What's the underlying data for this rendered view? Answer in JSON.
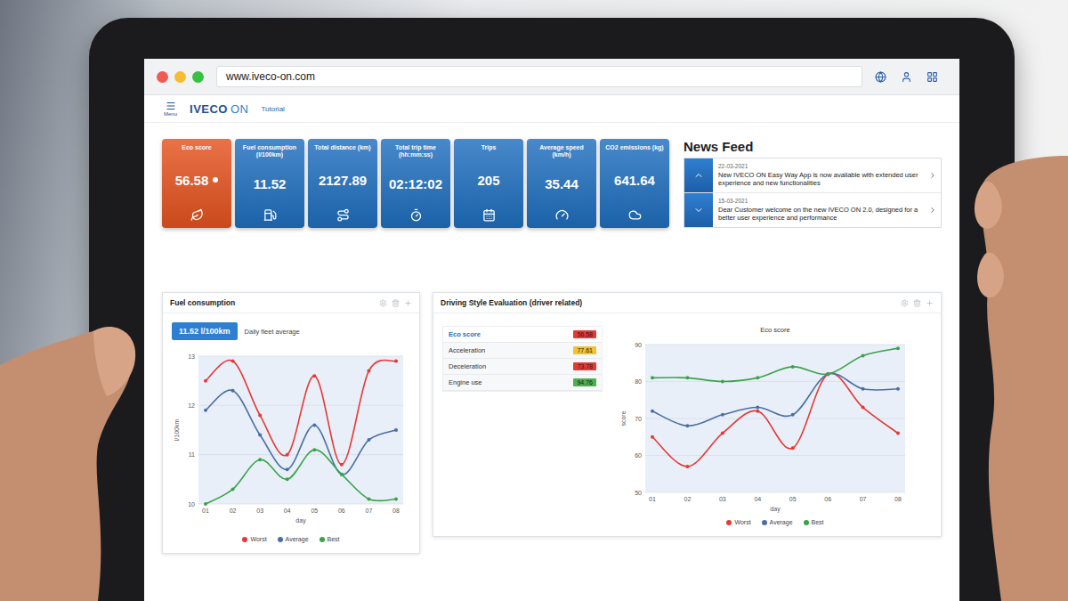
{
  "browser": {
    "url": "www.iveco-on.com"
  },
  "header": {
    "menu_label": "Menu",
    "logo_brand": "IVECO",
    "logo_product": "ON",
    "nav_link": "Tutorial"
  },
  "kpis": [
    {
      "label": "Eco score",
      "value": "56.58",
      "color": "#e5531f"
    },
    {
      "label": "Fuel consumption (l/100km)",
      "value": "11.52",
      "color": "#1f6fbf"
    },
    {
      "label": "Total distance (km)",
      "value": "2127.89",
      "color": "#1f6fbf"
    },
    {
      "label": "Total trip time (hh:mm:ss)",
      "value": "02:12:02",
      "color": "#1f6fbf"
    },
    {
      "label": "Trips",
      "value": "205",
      "color": "#1f6fbf"
    },
    {
      "label": "Average speed (km/h)",
      "value": "35.44",
      "color": "#1f6fbf"
    },
    {
      "label": "CO2 emissions (kg)",
      "value": "641.64",
      "color": "#1f6fbf"
    }
  ],
  "news_feed": {
    "title": "News Feed",
    "items": [
      {
        "date": "22-03-2021",
        "text": "New IVECO ON Easy Way App is now available with extended user experience and new functionalities"
      },
      {
        "date": "15-03-2021",
        "text": "Dear Customer welcome on the new IVECO ON 2.0, designed for a better user experience and performance"
      }
    ]
  },
  "fuel_panel": {
    "title": "Fuel consumption",
    "badge": "11.52 l/100km",
    "badge_caption": "Daily fleet average",
    "chart": {
      "y_label": "l/100km",
      "y_ticks": [
        "13",
        "12",
        "11",
        "10"
      ],
      "x_ticks": [
        "01",
        "02",
        "03",
        "04",
        "05",
        "06",
        "07",
        "08"
      ],
      "x_label": "day",
      "series": [
        {
          "name": "Worst",
          "color": "#e53935",
          "values": [
            12.5,
            12.9,
            11.8,
            11.0,
            12.6,
            10.8,
            12.7,
            12.9
          ]
        },
        {
          "name": "Average",
          "color": "#4a6fa5",
          "values": [
            11.9,
            12.3,
            11.4,
            10.7,
            11.6,
            10.6,
            11.3,
            11.5
          ]
        },
        {
          "name": "Best",
          "color": "#3aa34a",
          "values": [
            10.0,
            10.3,
            10.9,
            10.5,
            11.1,
            10.6,
            10.1,
            10.1
          ]
        }
      ]
    }
  },
  "driving_panel": {
    "title": "Driving Style Evaluation (driver related)",
    "rows": [
      {
        "label": "Eco score",
        "value": "56.58",
        "color": "#e53935",
        "selected": true
      },
      {
        "label": "Acceleration",
        "value": "77.61",
        "color": "#f2c230",
        "selected": false
      },
      {
        "label": "Deceleration",
        "value": "73.78",
        "color": "#e53935",
        "selected": false
      },
      {
        "label": "Engine use",
        "value": "94.76",
        "color": "#4caf50",
        "selected": false
      }
    ],
    "chart": {
      "title": "Eco score",
      "y_label": "score",
      "y_ticks": [
        "90",
        "80",
        "70",
        "60",
        "50"
      ],
      "x_ticks": [
        "01",
        "02",
        "03",
        "04",
        "05",
        "06",
        "07",
        "08"
      ],
      "x_label": "day",
      "series": [
        {
          "name": "Worst",
          "color": "#e53935",
          "values": [
            65,
            57,
            66,
            72,
            62,
            82,
            73,
            66
          ]
        },
        {
          "name": "Average",
          "color": "#4a6fa5",
          "values": [
            72,
            68,
            71,
            73,
            71,
            82,
            78,
            78
          ]
        },
        {
          "name": "Best",
          "color": "#3aa34a",
          "values": [
            81,
            81,
            80,
            81,
            84,
            82,
            87,
            89
          ]
        }
      ]
    }
  }
}
